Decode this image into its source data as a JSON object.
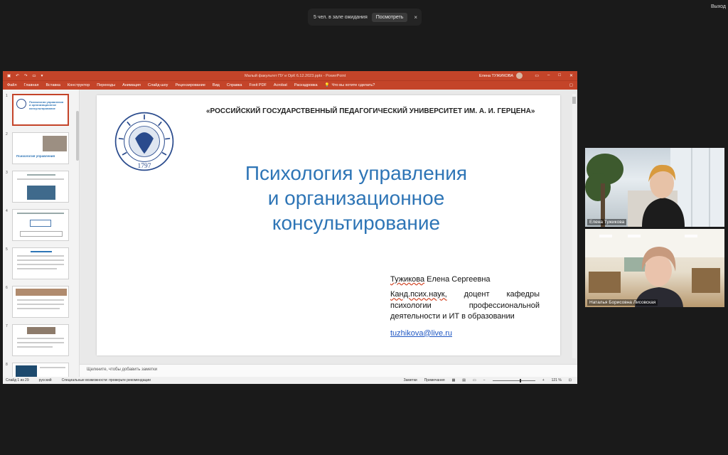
{
  "notice": {
    "text": "5 чел. в зале ожидания",
    "button": "Посмотреть",
    "close": "×"
  },
  "exit_label": "Выход",
  "ppt": {
    "doc_title": "Малый факультет ПУ и ОрК 6.12.2023.pptx  -  PowerPoint",
    "user_name": "Елена ТУЖИКОВА",
    "ribbon_tabs": [
      "Файл",
      "Главная",
      "Вставка",
      "Конструктор",
      "Переходы",
      "Анимация",
      "Слайд-шоу",
      "Рецензирование",
      "Вид",
      "Справка",
      "Foxit PDF",
      "Acrobat",
      "Раскадровка"
    ],
    "search_text": "Что вы хотите сделать?",
    "thumb_numbers": [
      "1",
      "2",
      "3",
      "4",
      "5",
      "6",
      "7",
      "8"
    ],
    "thumb2_text": "Психология управления",
    "thumb1_text": "Психология управления и организационное консультирование",
    "slide": {
      "university": "«РОССИЙСКИЙ ГОСУДАРСТВЕННЫЙ  ПЕДАГОГИЧЕСКИЙ УНИВЕРСИТЕТ ИМ. А. И. ГЕРЦЕНА»",
      "title_line1": "Психология управления",
      "title_line2": "и организационное",
      "title_line3": "консультирование",
      "author_name_ul": "Тужикова",
      "author_name_rest": " Елена Сергеевна",
      "degree_ul": "Канд.псих.наук,",
      "pos_w1": "доцент",
      "pos_w2": "кафедры",
      "pos_w3": "психологии",
      "pos_w4": "профессиональной",
      "pos_line3": "деятельности и ИТ в образовании",
      "email": "tuzhikova@live.ru",
      "seal_year": "1797"
    },
    "notes_placeholder": "Щелкните, чтобы добавить заметки",
    "status": {
      "slide_counter": "Слайд 1 из 29",
      "language": "русский",
      "accessibility": "Специальные возможности: проверьте рекомендации",
      "notes": "Заметки",
      "comments": "Примечания",
      "zoom": "121 %"
    }
  },
  "participants": [
    {
      "name": "Елена Тужикова"
    },
    {
      "name": "Наталья Борисовна Лисовская"
    }
  ]
}
